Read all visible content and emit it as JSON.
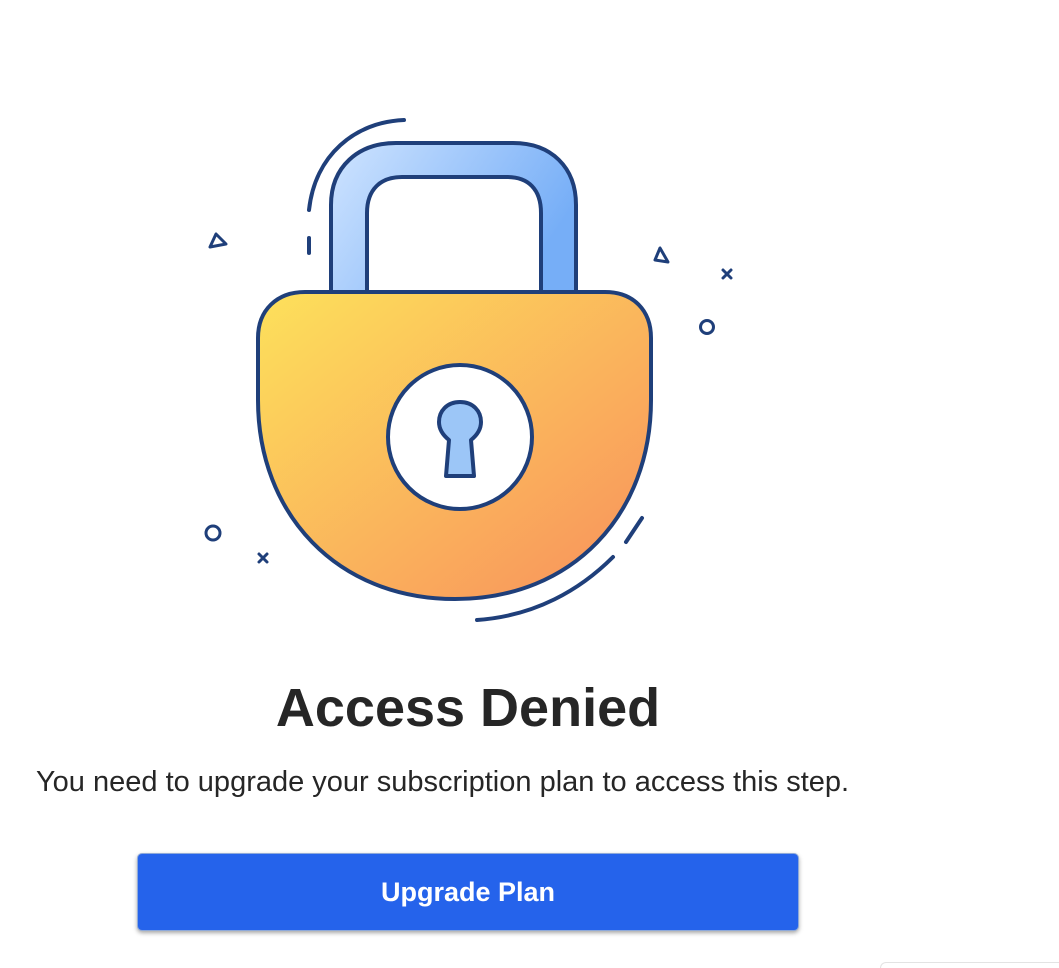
{
  "illustration": {
    "name": "padlock-illustration",
    "colors": {
      "outline": "#1f3f7a",
      "shackle_light": "#cfe4ff",
      "shackle_dark": "#76aef7",
      "body_light": "#fde15b",
      "body_dark": "#f89a5c",
      "keyhole_fill": "#9cc6f7",
      "keyhole_circle": "#ffffff"
    }
  },
  "title": "Access Denied",
  "message": "You need to upgrade your subscription plan to access this step.",
  "upgrade_button": {
    "label": "Upgrade Plan",
    "color": "#2563eb"
  }
}
